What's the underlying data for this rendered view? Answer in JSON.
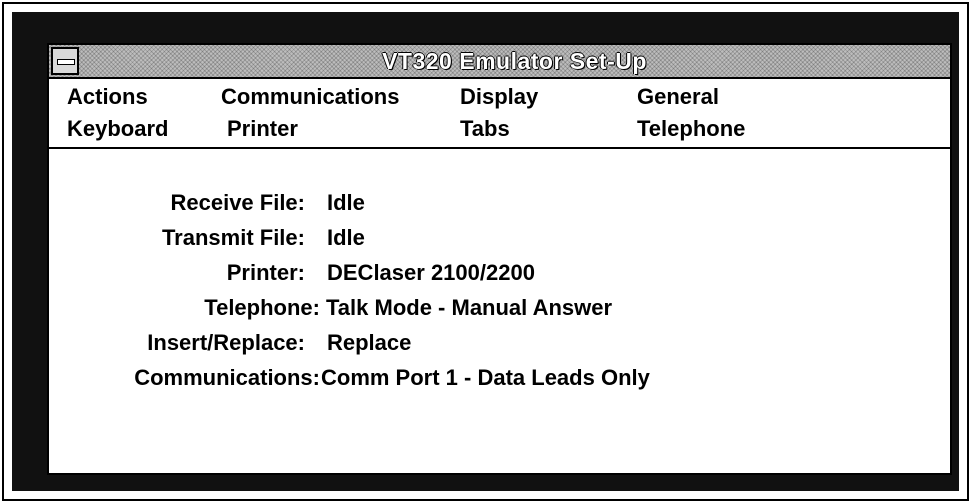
{
  "window": {
    "title": "VT320 Emulator  Set-Up"
  },
  "menu": {
    "row1": [
      "Actions",
      "Communications",
      "Display",
      "General"
    ],
    "row2": [
      "Keyboard",
      "Printer",
      "Tabs",
      "Telephone"
    ]
  },
  "status": [
    {
      "label": "Receive File:",
      "value": "Idle"
    },
    {
      "label": "Transmit File:",
      "value": "Idle"
    },
    {
      "label": "Printer:",
      "value": "DEClaser 2100/2200"
    },
    {
      "label": "Telephone:",
      "value": "Talk Mode - Manual Answer"
    },
    {
      "label": "Insert/Replace:",
      "value": "Replace"
    },
    {
      "label": "Communications:",
      "value": "Comm Port 1 - Data Leads Only"
    }
  ],
  "icons": {
    "system_menu": "system-menu-icon"
  }
}
